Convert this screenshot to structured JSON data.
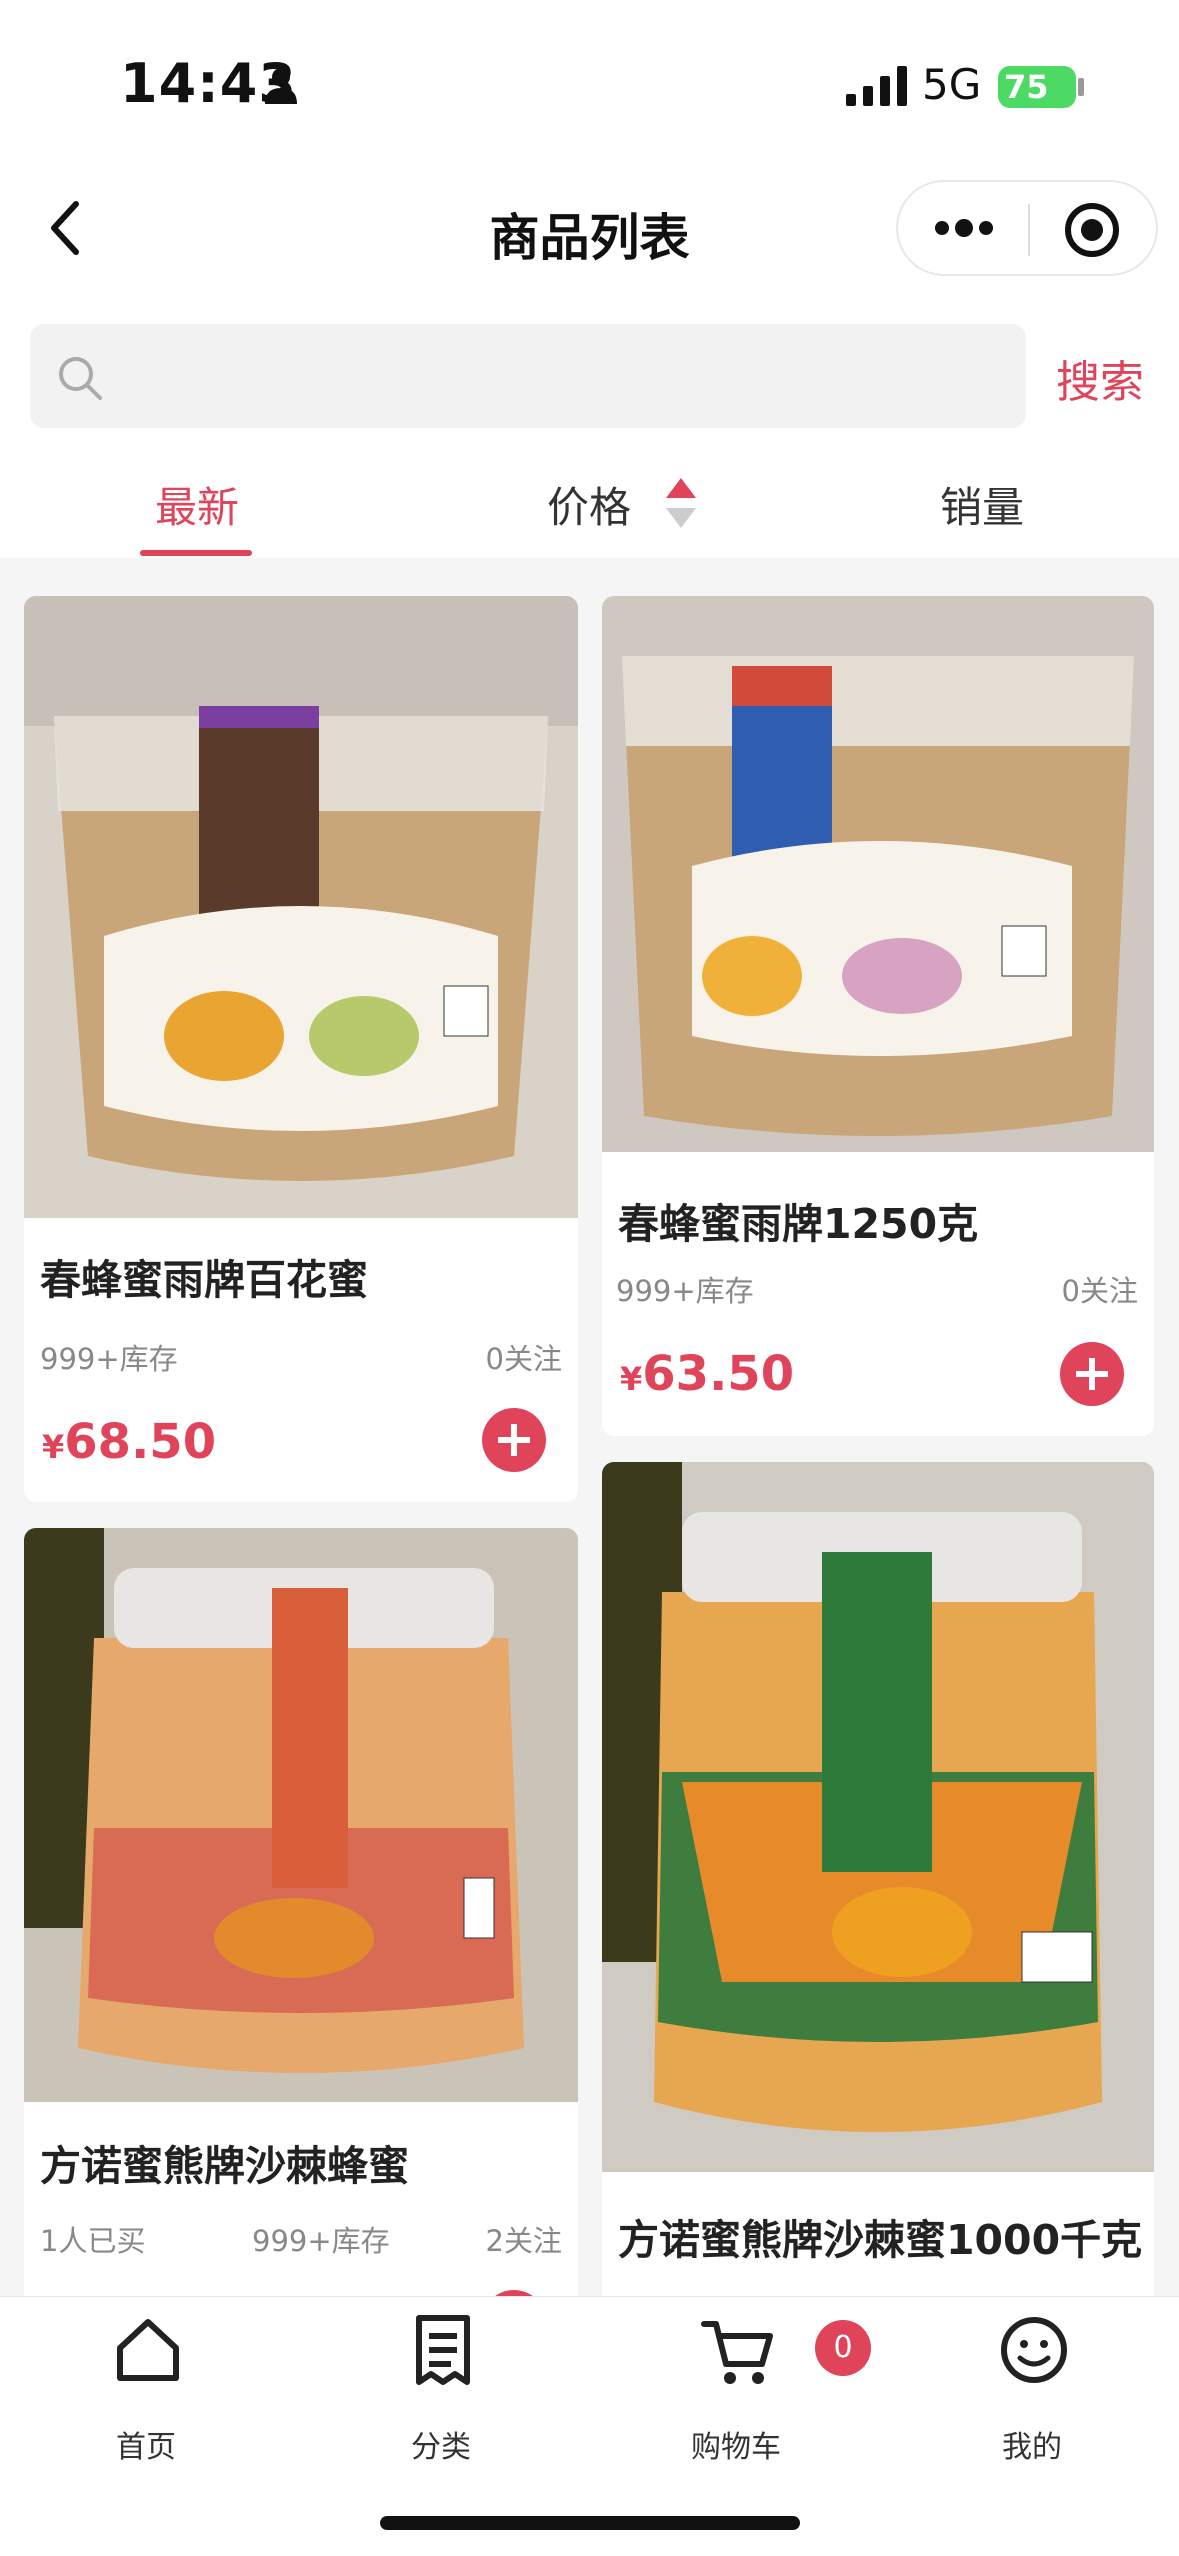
{
  "status_bar": {
    "time": "14:43",
    "network": "5G",
    "battery": "75"
  },
  "nav": {
    "title": "商品列表"
  },
  "search": {
    "placeholder": "",
    "button_label": "搜索"
  },
  "sort_tabs": [
    {
      "label": "最新",
      "active": true
    },
    {
      "label": "价格",
      "active": false
    },
    {
      "label": "销量",
      "active": false
    }
  ],
  "products": [
    {
      "name": "春蜂蜜雨牌百花蜜",
      "stock": "999+库存",
      "follows": "0关注",
      "currency": "¥",
      "price": "68.50",
      "image": "honey-tub-linden-brown-label"
    },
    {
      "name": "春蜂蜜雨牌1250克",
      "stock": "999+库存",
      "follows": "0关注",
      "currency": "¥",
      "price": "63.50",
      "image": "honey-tub-flower-blue-label"
    },
    {
      "name": "方诺蜜熊牌沙棘蜂蜜",
      "bought": "1人已买",
      "stock": "999+库存",
      "follows": "2关注",
      "image": "honey-jar-sea-buckthorn-red-label"
    },
    {
      "name": "方诺蜜熊牌沙棘蜜1000千克",
      "image": "honey-jar-sea-buckthorn-green-label"
    }
  ],
  "tab_bar": {
    "items": [
      {
        "label": "首页",
        "icon": "home-icon"
      },
      {
        "label": "分类",
        "icon": "list-icon"
      },
      {
        "label": "购物车",
        "icon": "cart-icon"
      },
      {
        "label": "我的",
        "icon": "smile-icon"
      }
    ],
    "cart_badge": "0"
  },
  "colors": {
    "accent": "#e0445a",
    "background": "#f5f5f5"
  }
}
